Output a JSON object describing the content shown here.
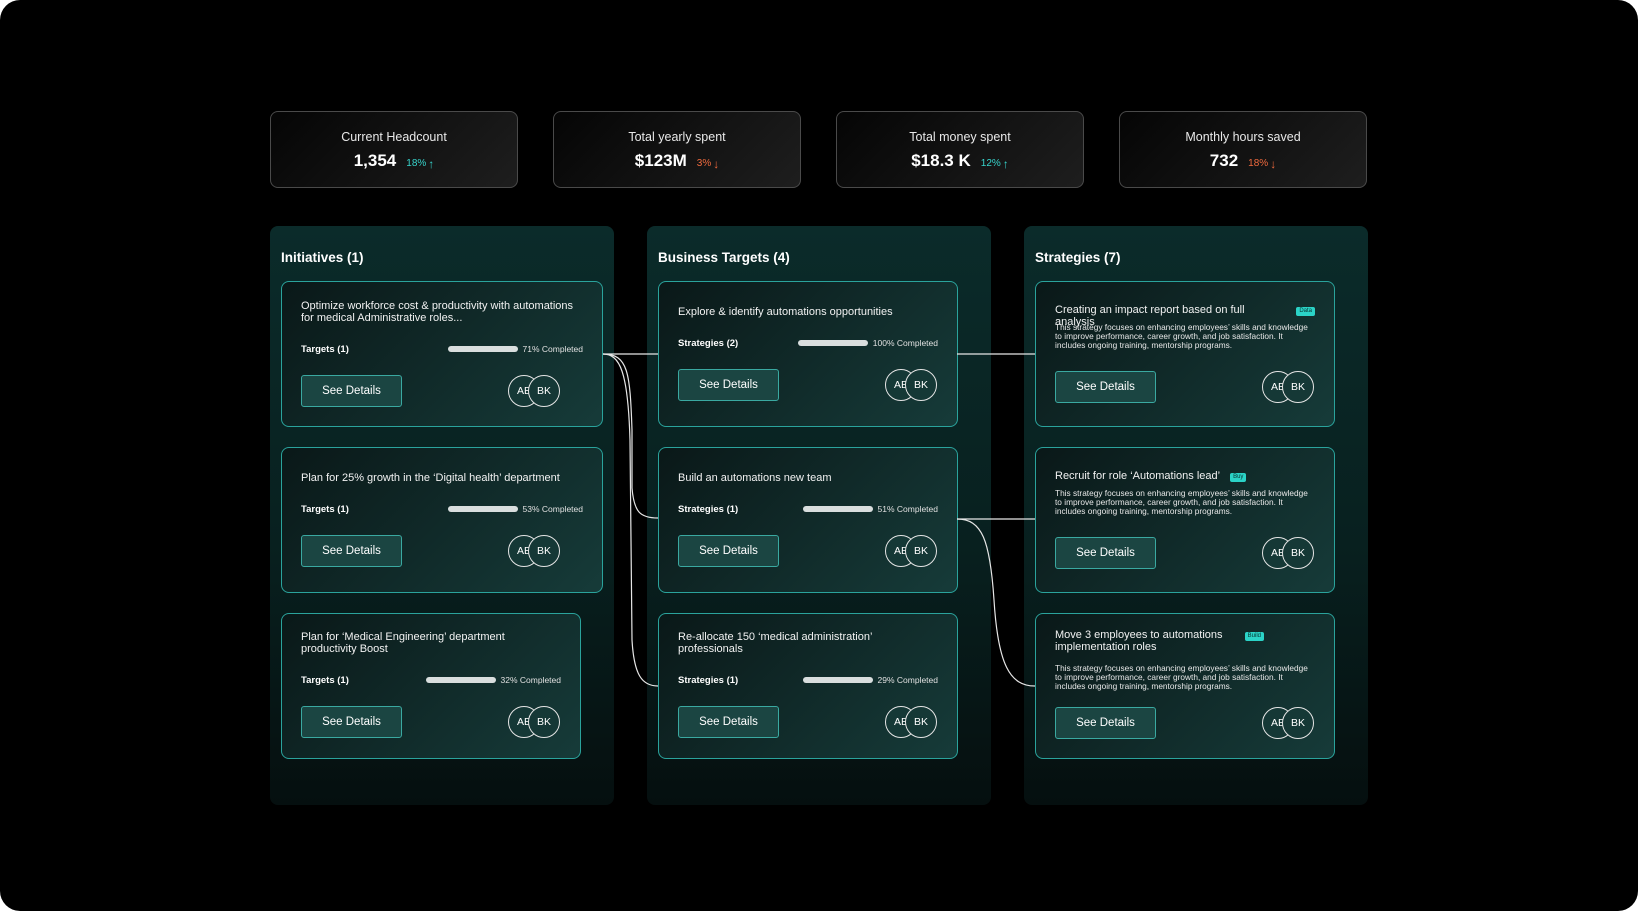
{
  "stats": [
    {
      "label": "Current Headcount",
      "value": "1,354",
      "change": "18%",
      "direction": "up"
    },
    {
      "label": "Total yearly spent",
      "value": "$123M",
      "change": "3%",
      "direction": "down"
    },
    {
      "label": "Total money spent",
      "value": "$18.3 K",
      "change": "12%",
      "direction": "up"
    },
    {
      "label": "Monthly hours saved",
      "value": "732",
      "change": "18%",
      "direction": "down"
    }
  ],
  "colors": {
    "accent": "#2aa39c",
    "up": "#37d3cb",
    "down": "#f06a3e",
    "tag": "#2bd3c7"
  },
  "icons": {
    "up": "arrow-up-icon",
    "down": "arrow-down-icon"
  },
  "initiatives": {
    "title": "Initiatives (1)",
    "cards": [
      {
        "title": "Optimize workforce cost & productivity with automations for medical Administrative roles...",
        "row_label": "Targets (1)",
        "progress": 71,
        "pct_label": "71% Completed",
        "button": "See Details",
        "avatars": [
          "AE",
          "BK"
        ]
      },
      {
        "title": "Plan for 25% growth in the ‘Digital health’ department",
        "row_label": "Targets (1)",
        "progress": 53,
        "pct_label": "53% Completed",
        "button": "See Details",
        "avatars": [
          "AE",
          "BK"
        ]
      },
      {
        "title": "Plan for ‘Medical Engineering’ department productivity Boost",
        "row_label": "Targets (1)",
        "progress": 32,
        "pct_label": "32% Completed",
        "button": "See Details",
        "avatars": [
          "AE",
          "BK"
        ]
      }
    ]
  },
  "targets": {
    "title": "Business Targets (4)",
    "cards": [
      {
        "title": "Explore & identify automations opportunities",
        "row_label": "Strategies (2)",
        "progress": 100,
        "pct_label": "100% Completed",
        "button": "See Details",
        "avatars": [
          "AE",
          "BK"
        ]
      },
      {
        "title": "Build an automations new team",
        "row_label": "Strategies (1)",
        "progress": 51,
        "pct_label": "51% Completed",
        "button": "See Details",
        "avatars": [
          "AE",
          "BK"
        ]
      },
      {
        "title": "Re-allocate 150 ‘medical administration’ professionals",
        "row_label": "Strategies (1)",
        "progress": 29,
        "pct_label": "29% Completed",
        "button": "See Details",
        "avatars": [
          "AE",
          "BK"
        ]
      }
    ]
  },
  "strategies": {
    "title": "Strategies (7)",
    "cards": [
      {
        "title": "Creating an impact report based on full analysis",
        "tag": "Data",
        "description": "This strategy focuses on enhancing employees’ skills and knowledge to improve performance, career growth, and job satisfaction. It includes ongoing training, mentorship programs.",
        "button": "See Details",
        "avatars": [
          "AE",
          "BK"
        ]
      },
      {
        "title": "Recruit for role ‘Automations lead’",
        "tag": "Buy",
        "description": "This strategy focuses on enhancing employees’ skills and knowledge to improve performance, career growth, and job satisfaction. It includes ongoing training, mentorship programs.",
        "button": "See Details",
        "avatars": [
          "AE",
          "BK"
        ]
      },
      {
        "title": "Move 3 employees to automations implementation roles",
        "tag": "Build",
        "description": "This strategy focuses on enhancing employees’ skills and knowledge to improve performance, career growth, and job satisfaction. It includes ongoing training, mentorship programs.",
        "button": "See Details",
        "avatars": [
          "AE",
          "BK"
        ]
      }
    ]
  }
}
